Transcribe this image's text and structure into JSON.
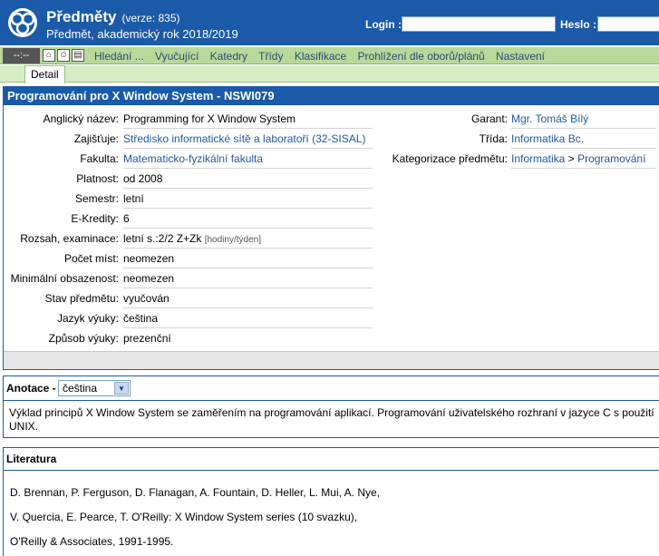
{
  "header": {
    "title": "Předměty",
    "version": "(verze: 835)",
    "subtitle": "Předmět, akademický rok 2018/2019",
    "login_label": "Login :",
    "heslo_label": "Heslo :"
  },
  "menu": {
    "dark_label": "--:--",
    "items": [
      "Hledání ...",
      "Vyučující",
      "Katedry",
      "Třídy",
      "Klasifikace",
      "Prohlížení dle oborů/plánů",
      "Nastavení"
    ]
  },
  "tabs": {
    "detail": "Detail"
  },
  "course": {
    "title": "Programování pro X Window System - NSWI079",
    "left_rows": [
      {
        "label": "Anglický název:",
        "value": "Programming for X Window System"
      },
      {
        "label": "Zajišťuje:",
        "value": "Středisko informatické sítě a laboratoří (32-SISAL)"
      },
      {
        "label": "Fakulta:",
        "value": "Matematicko-fyzikální fakulta"
      },
      {
        "label": "Platnost:",
        "value": "od 2008"
      },
      {
        "label": "Semestr:",
        "value": "letní"
      },
      {
        "label": "E-Kredity:",
        "value": "6"
      },
      {
        "label": "Rozsah, examinace:",
        "value": "letní s.:2/2 Z+Zk",
        "note": "[hodiny/týden]"
      },
      {
        "label": "Počet míst:",
        "value": "neomezen"
      },
      {
        "label": "Minimální obsazenost:",
        "value": "neomezen"
      },
      {
        "label": "Stav předmětu:",
        "value": "vyučován"
      },
      {
        "label": "Jazyk výuky:",
        "value": "čeština"
      },
      {
        "label": "Způsob výuky:",
        "value": "prezenční"
      }
    ],
    "right_rows": [
      {
        "label": "Garant:",
        "value": "Mgr. Tomáš Bílý"
      },
      {
        "label": "Třída:",
        "value": "Informatika Bc."
      },
      {
        "label": "Kategorizace předmětu:",
        "value1": "Informatika",
        "sep": ">",
        "value2": "Programování"
      }
    ]
  },
  "annotation": {
    "label": "Anotace -",
    "language": "čeština",
    "text_line1": "Výklad principů X Window System se zaměřením na programování aplikací. Programování uživatelského rozhraní v jazyce C s použití",
    "text_line2": "UNIX."
  },
  "literature": {
    "label": "Literatura",
    "lines": [
      "D. Brennan, P. Ferguson, D. Flanagan, A. Fountain, D. Heller, L. Mui, A. Nye,",
      "V. Quercia, E. Pearce, T. O'Reilly: X Window System series (10 svazku),",
      "O'Reilly & Associates, 1991-1995."
    ]
  }
}
